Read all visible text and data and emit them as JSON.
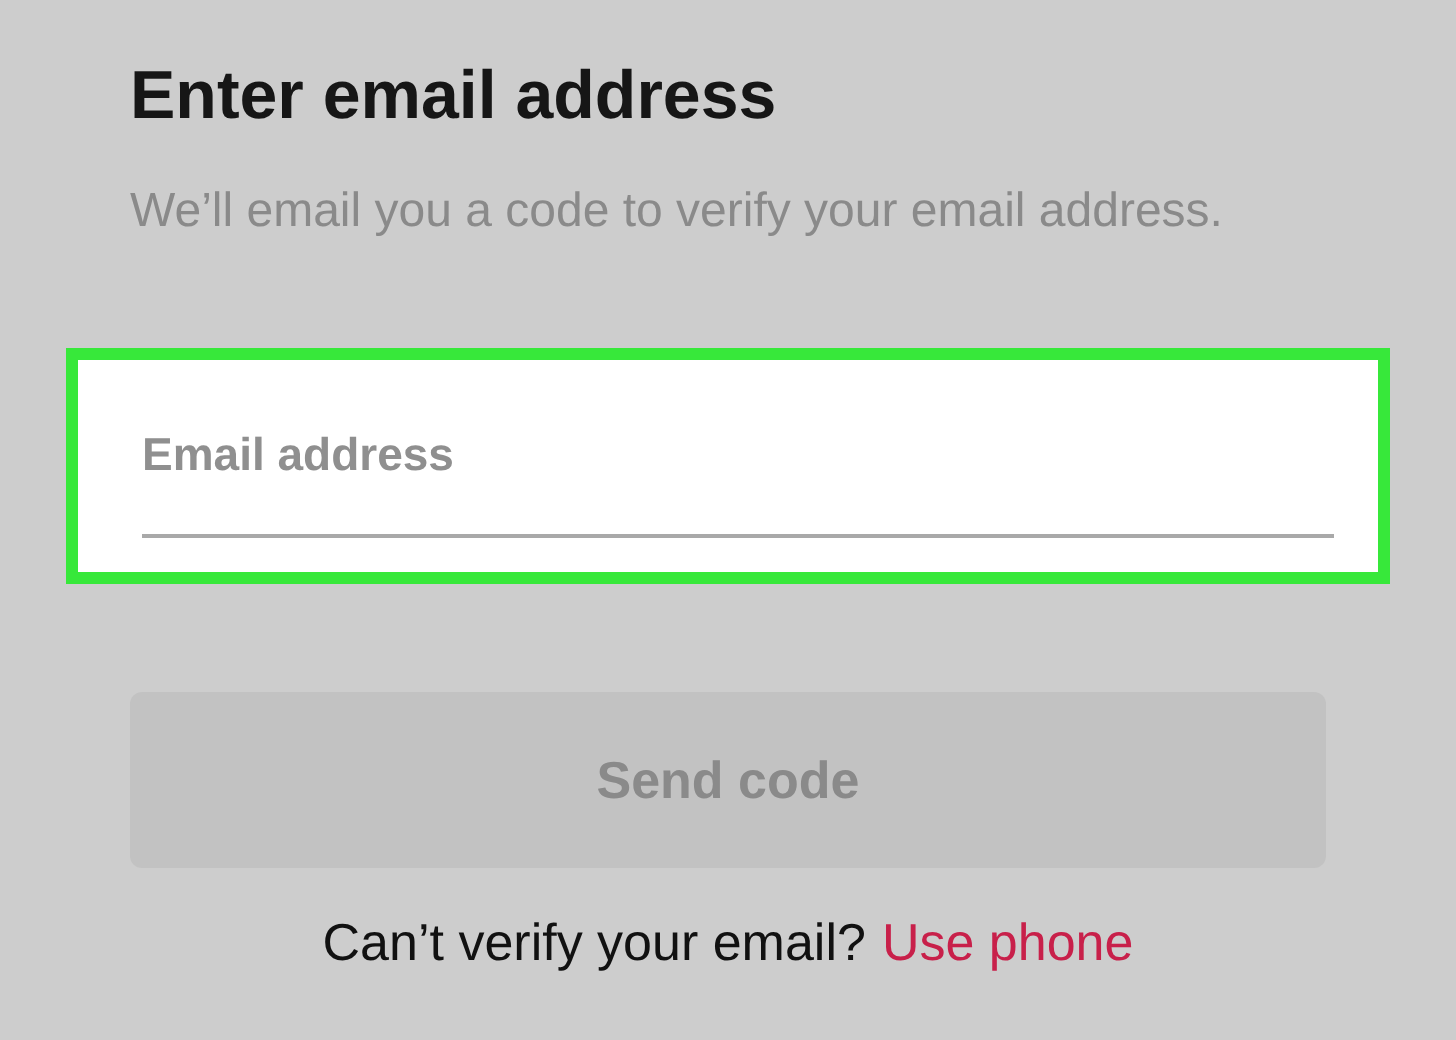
{
  "heading": "Enter email address",
  "description": "We’ll email you a code to verify your email address.",
  "email_field": {
    "placeholder": "Email address",
    "highlighted": true
  },
  "send_button": {
    "label": "Send code",
    "disabled": true
  },
  "footer": {
    "text": "Can’t verify your email?",
    "link": "Use phone"
  }
}
